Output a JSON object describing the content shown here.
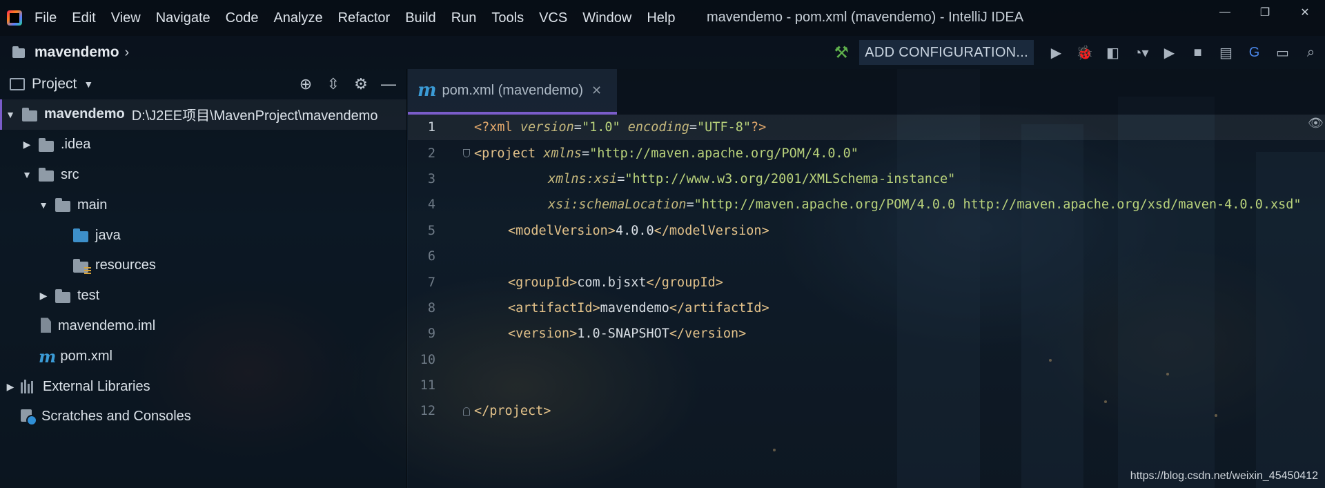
{
  "window": {
    "title": "mavendemo - pom.xml (mavendemo) - IntelliJ IDEA",
    "controls": [
      "—",
      "❐",
      "✕"
    ]
  },
  "menu": [
    "File",
    "Edit",
    "View",
    "Navigate",
    "Code",
    "Analyze",
    "Refactor",
    "Build",
    "Run",
    "Tools",
    "VCS",
    "Window",
    "Help"
  ],
  "navbar": {
    "breadcrumb": "mavendemo",
    "add_configuration": "ADD CONFIGURATION..."
  },
  "project_panel": {
    "title": "Project",
    "tree": [
      {
        "label": "mavendemo",
        "path": "D:\\J2EE项目\\MavenProject\\mavendemo"
      },
      {
        "label": ".idea"
      },
      {
        "label": "src"
      },
      {
        "label": "main"
      },
      {
        "label": "java"
      },
      {
        "label": "resources"
      },
      {
        "label": "test"
      },
      {
        "label": "mavendemo.iml"
      },
      {
        "label": "pom.xml"
      },
      {
        "label": "External Libraries"
      },
      {
        "label": "Scratches and Consoles"
      }
    ]
  },
  "editor": {
    "tab_label": "pom.xml (mavendemo)",
    "line_numbers": [
      "1",
      "2",
      "3",
      "4",
      "5",
      "6",
      "7",
      "8",
      "9",
      "10",
      "11",
      "12"
    ],
    "lines": {
      "l1": {
        "open": "<?xml ",
        "a1": "version",
        "eq1": "=",
        "v1": "\"1.0\"",
        "a2": "encoding",
        "eq2": "=",
        "v2": "\"UTF-8\"",
        "close": "?>"
      },
      "l2": {
        "open": "<project ",
        "a1": "xmlns",
        "eq1": "=",
        "v1": "\"http://maven.apache.org/POM/4.0.0\""
      },
      "l3": {
        "a1": "xmlns:xsi",
        "eq1": "=",
        "v1": "\"http://www.w3.org/2001/XMLSchema-instance\""
      },
      "l4": {
        "a1": "xsi:schemaLocation",
        "eq1": "=",
        "v1": "\"http://maven.apache.org/POM/4.0.0 http://maven.apache.org/xsd/maven-4.0.0.xsd\""
      },
      "l5": {
        "open": "<modelVersion>",
        "text": "4.0.0",
        "close": "</modelVersion>"
      },
      "l7": {
        "open": "<groupId>",
        "text": "com.bjsxt",
        "close": "</groupId>"
      },
      "l8": {
        "open": "<artifactId>",
        "text": "mavendemo",
        "close": "</artifactId>"
      },
      "l9": {
        "open": "<version>",
        "text": "1.0-SNAPSHOT",
        "close": "</version>"
      },
      "l12": {
        "close": "</project>"
      }
    }
  },
  "watermark": "https://blog.csdn.net/weixin_45450412",
  "colors": {
    "accent": "#7a5cc9",
    "tag": "#e3c28a",
    "string": "#b9d27b",
    "attribute": "#c6b97d",
    "run_green": "#5fb04c",
    "maven_blue": "#3b9bd6"
  }
}
